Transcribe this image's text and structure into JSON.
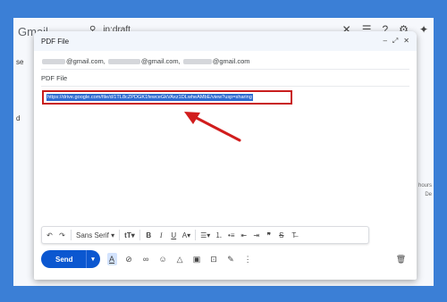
{
  "background": {
    "color": "#3b7fd6"
  },
  "gmail": {
    "logo": "Gmail",
    "search_query": "in:draft",
    "sidebar_text_1": "se",
    "sidebar_text_2": "d",
    "right_text_1": "hours",
    "right_text_2": "De"
  },
  "compose": {
    "title": "PDF File",
    "to_parts": [
      "@gmail.com,",
      "@gmail.com,",
      "@gmail.com"
    ],
    "subject": "PDF File",
    "link_text": "https://drive.google.com/file/d/1TL8cZPDGK1fewceGkVAxz1DLwheAMbE/view?usp=sharing",
    "highlight_color": "#c81e1e",
    "selection_color": "#2f6cd0"
  },
  "format_bar": {
    "font": "Sans Serif",
    "items": [
      "undo-icon",
      "redo-icon",
      "font-family",
      "text-size-icon",
      "bold",
      "italic",
      "underline",
      "text-color-icon",
      "align-icon",
      "numbered-list-icon",
      "bulleted-list-icon",
      "indent-less-icon",
      "indent-more-icon",
      "quote-icon",
      "strikethrough-icon",
      "remove-format-icon"
    ]
  },
  "bottom_bar": {
    "send_label": "Send",
    "send_color": "#0b57d0"
  }
}
